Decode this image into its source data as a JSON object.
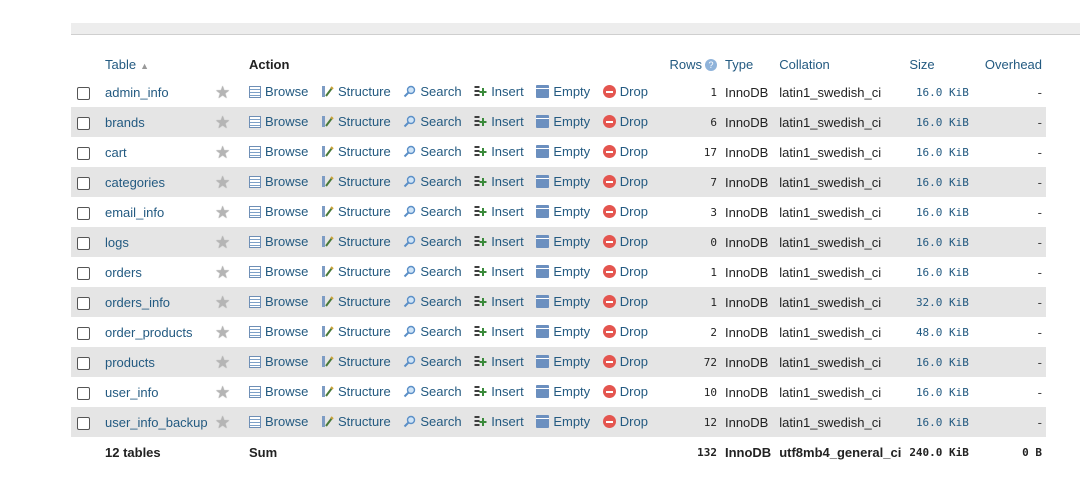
{
  "header": {
    "table": "Table",
    "sort_indicator": "▲",
    "action": "Action",
    "rows": "Rows",
    "rows_help": "?",
    "type": "Type",
    "collation": "Collation",
    "size": "Size",
    "overhead": "Overhead"
  },
  "actions": {
    "browse": "Browse",
    "structure": "Structure",
    "search": "Search",
    "insert": "Insert",
    "empty": "Empty",
    "drop": "Drop"
  },
  "rows": [
    {
      "name": "admin_info",
      "rows": "1",
      "type": "InnoDB",
      "collation": "latin1_swedish_ci",
      "size": "16.0 KiB",
      "overhead": "-"
    },
    {
      "name": "brands",
      "rows": "6",
      "type": "InnoDB",
      "collation": "latin1_swedish_ci",
      "size": "16.0 KiB",
      "overhead": "-"
    },
    {
      "name": "cart",
      "rows": "17",
      "type": "InnoDB",
      "collation": "latin1_swedish_ci",
      "size": "16.0 KiB",
      "overhead": "-"
    },
    {
      "name": "categories",
      "rows": "7",
      "type": "InnoDB",
      "collation": "latin1_swedish_ci",
      "size": "16.0 KiB",
      "overhead": "-"
    },
    {
      "name": "email_info",
      "rows": "3",
      "type": "InnoDB",
      "collation": "latin1_swedish_ci",
      "size": "16.0 KiB",
      "overhead": "-"
    },
    {
      "name": "logs",
      "rows": "0",
      "type": "InnoDB",
      "collation": "latin1_swedish_ci",
      "size": "16.0 KiB",
      "overhead": "-"
    },
    {
      "name": "orders",
      "rows": "1",
      "type": "InnoDB",
      "collation": "latin1_swedish_ci",
      "size": "16.0 KiB",
      "overhead": "-"
    },
    {
      "name": "orders_info",
      "rows": "1",
      "type": "InnoDB",
      "collation": "latin1_swedish_ci",
      "size": "32.0 KiB",
      "overhead": "-"
    },
    {
      "name": "order_products",
      "rows": "2",
      "type": "InnoDB",
      "collation": "latin1_swedish_ci",
      "size": "48.0 KiB",
      "overhead": "-"
    },
    {
      "name": "products",
      "rows": "72",
      "type": "InnoDB",
      "collation": "latin1_swedish_ci",
      "size": "16.0 KiB",
      "overhead": "-"
    },
    {
      "name": "user_info",
      "rows": "10",
      "type": "InnoDB",
      "collation": "latin1_swedish_ci",
      "size": "16.0 KiB",
      "overhead": "-"
    },
    {
      "name": "user_info_backup",
      "rows": "12",
      "type": "InnoDB",
      "collation": "latin1_swedish_ci",
      "size": "16.0 KiB",
      "overhead": "-"
    }
  ],
  "footer": {
    "tables": "12 tables",
    "sum": "Sum",
    "rows": "132",
    "type": "InnoDB",
    "collation": "utf8mb4_general_ci",
    "size": "240.0 KiB",
    "overhead": "0 B"
  },
  "colors": {
    "link": "#235a81",
    "row_alt": "#e5e5e5",
    "drop_icon": "#e4554f"
  }
}
